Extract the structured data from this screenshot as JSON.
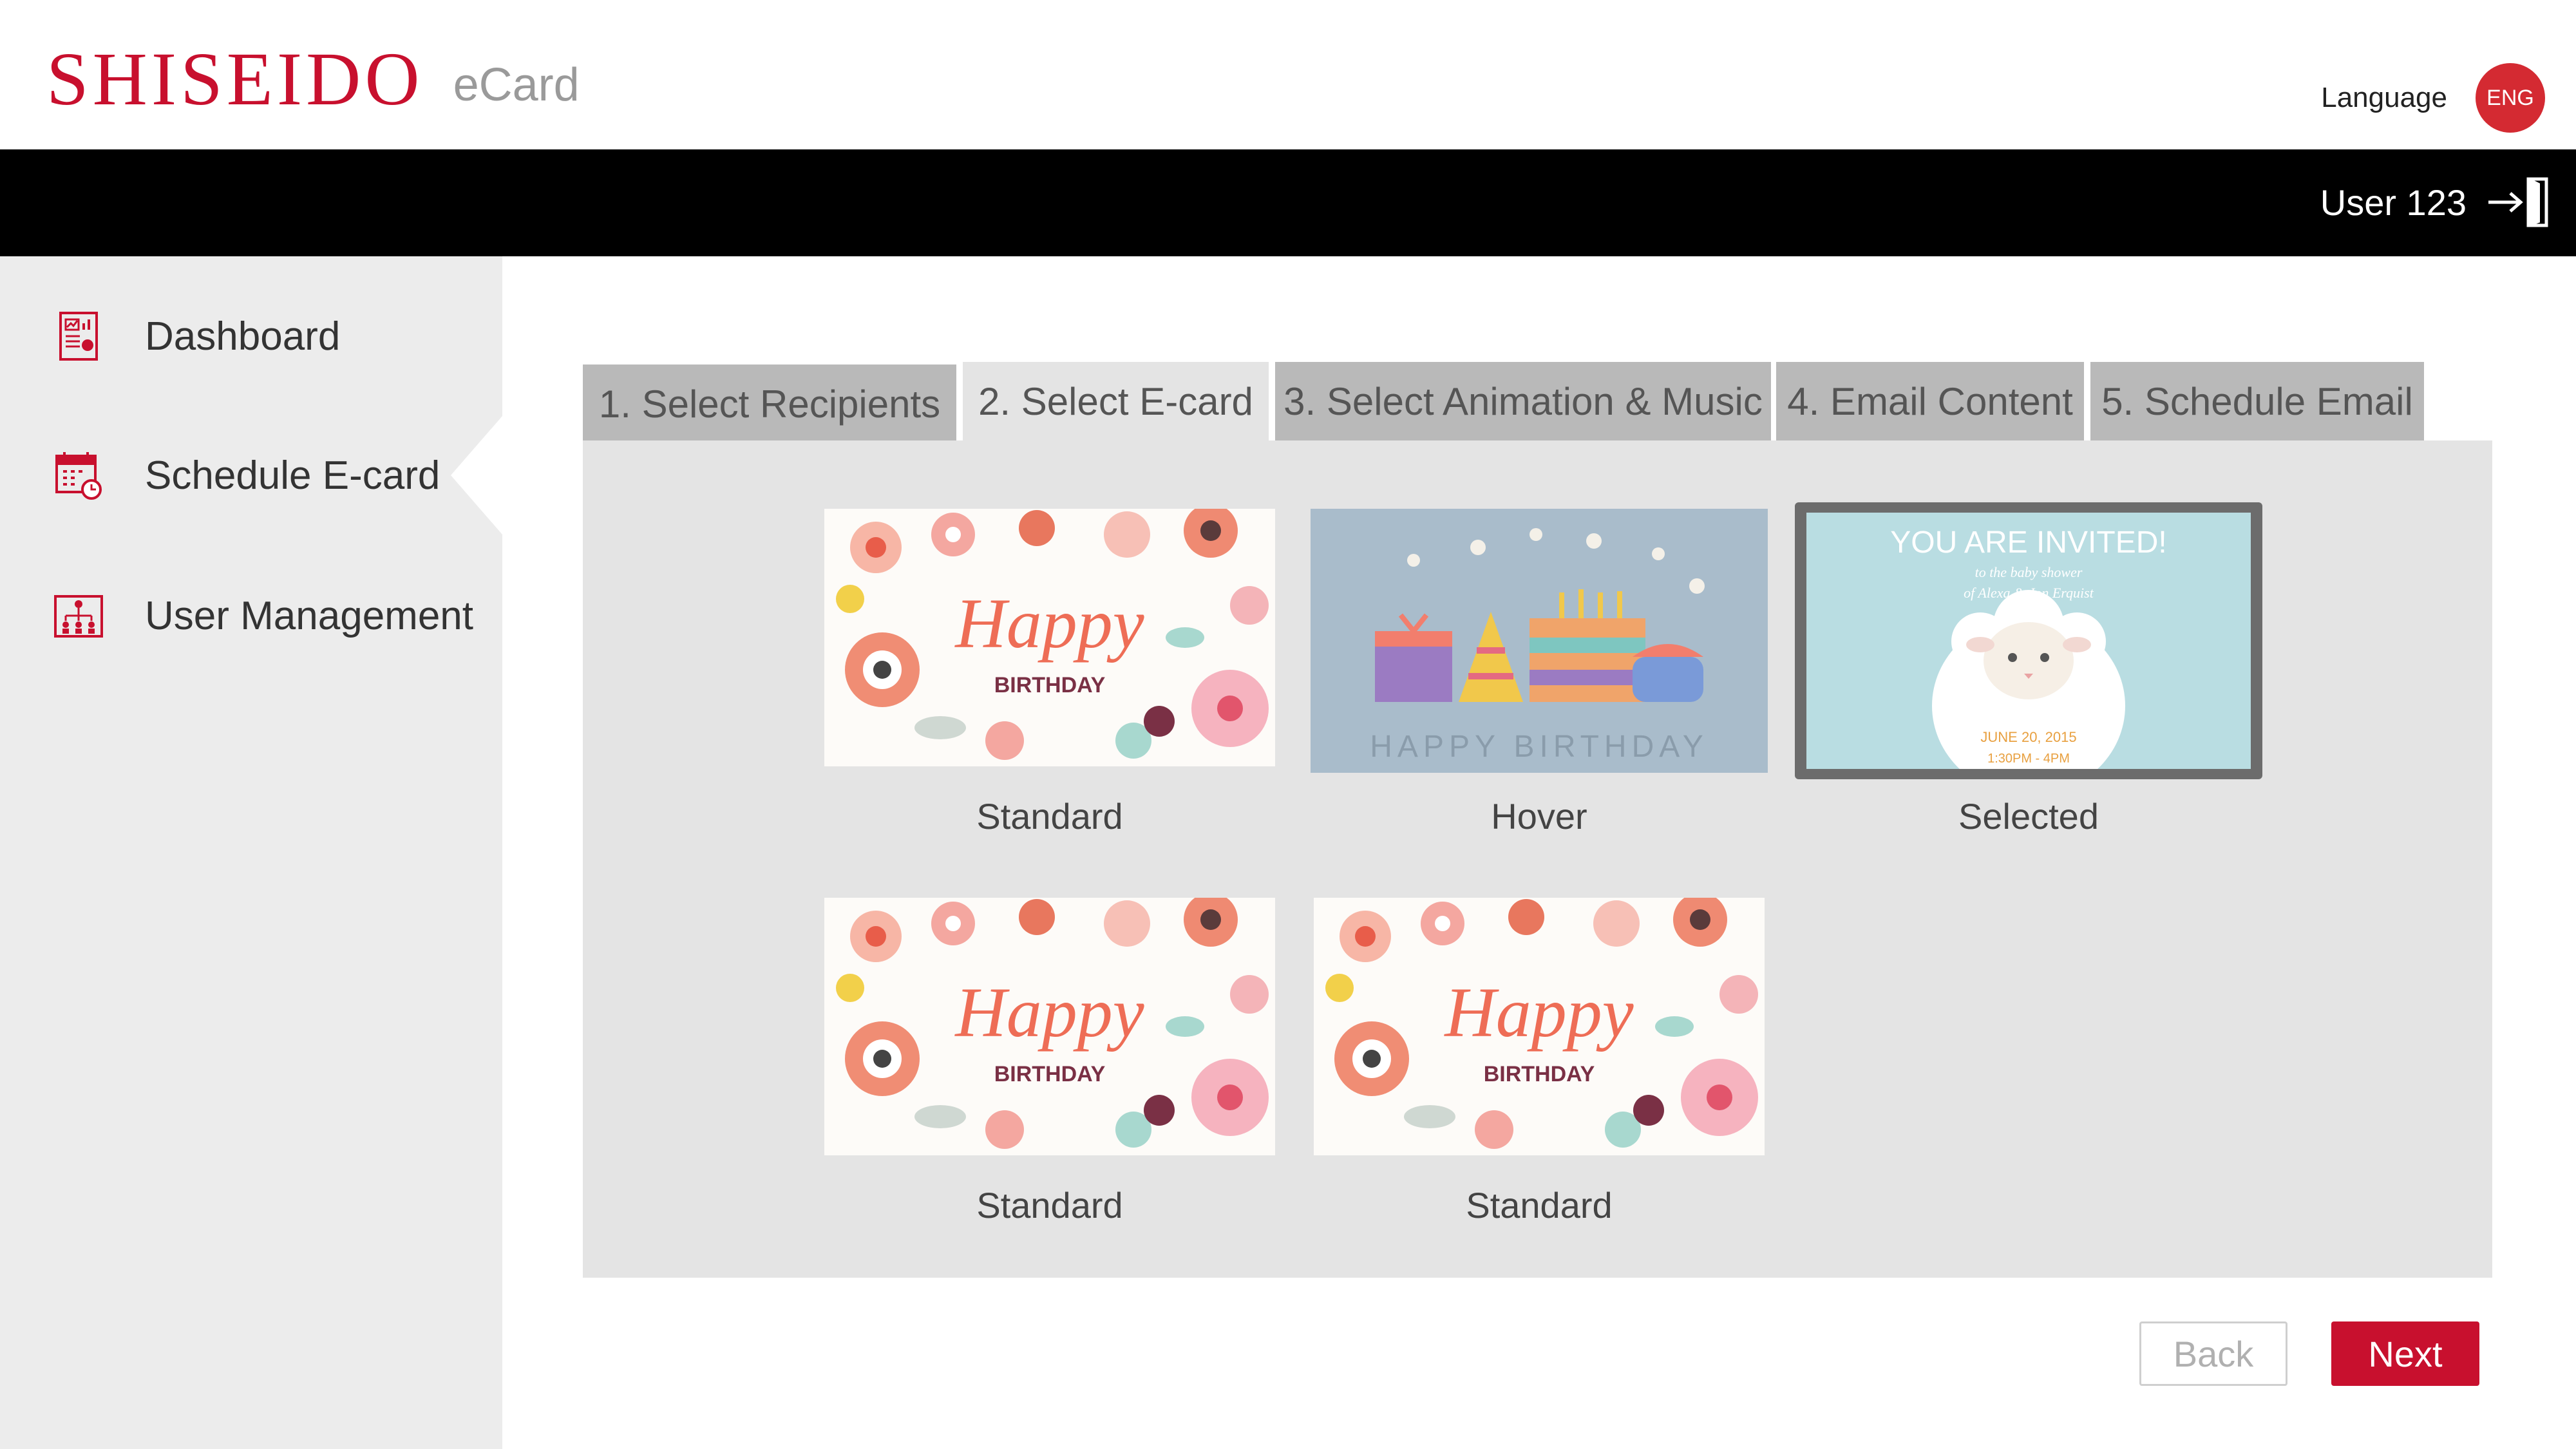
{
  "brand": {
    "logo_text": "SHISEIDO",
    "product": "eCard",
    "color": "#c8102e"
  },
  "header": {
    "language_label": "Language",
    "language_code": "ENG"
  },
  "topbar": {
    "user_name": "User 123",
    "logout_icon": "logout-door-icon"
  },
  "sidebar": {
    "items": [
      {
        "label": "Dashboard",
        "icon": "dashboard-report-icon"
      },
      {
        "label": "Schedule E-card",
        "icon": "calendar-clock-icon",
        "active": true
      },
      {
        "label": "User Management",
        "icon": "org-chart-icon"
      }
    ]
  },
  "tabs": [
    {
      "label": "1. Select Recipients"
    },
    {
      "label": "2. Select E-card",
      "active": true
    },
    {
      "label": "3. Select Animation & Music"
    },
    {
      "label": "4. Email Content"
    },
    {
      "label": "5. Schedule Email"
    }
  ],
  "cards": [
    {
      "caption": "Standard",
      "design": "floral-happy-birthday",
      "art_text": [
        "Happy",
        "BIRTHDAY"
      ]
    },
    {
      "caption": "Hover",
      "design": "gifts-and-cake",
      "art_text": [
        "HAPPY BIRTHDAY"
      ]
    },
    {
      "caption": "Selected",
      "design": "baby-shower-lamb",
      "art_text": [
        "YOU ARE INVITED!",
        "to the baby shower",
        "of Alexa & Jon Erquist",
        "JUNE 20, 2015",
        "1:30PM - 4PM"
      ]
    },
    {
      "caption": "Standard",
      "design": "floral-happy-birthday",
      "art_text": [
        "Happy",
        "BIRTHDAY"
      ]
    },
    {
      "caption": "Standard",
      "design": "floral-happy-birthday",
      "art_text": [
        "Happy",
        "BIRTHDAY"
      ]
    }
  ],
  "buttons": {
    "back": "Back",
    "next": "Next"
  },
  "colors": {
    "accent": "#c8102e",
    "topbar": "#000000",
    "sidebar": "#ececec",
    "panel": "#e4e4e4",
    "tab_inactive": "#b9b9b9"
  }
}
